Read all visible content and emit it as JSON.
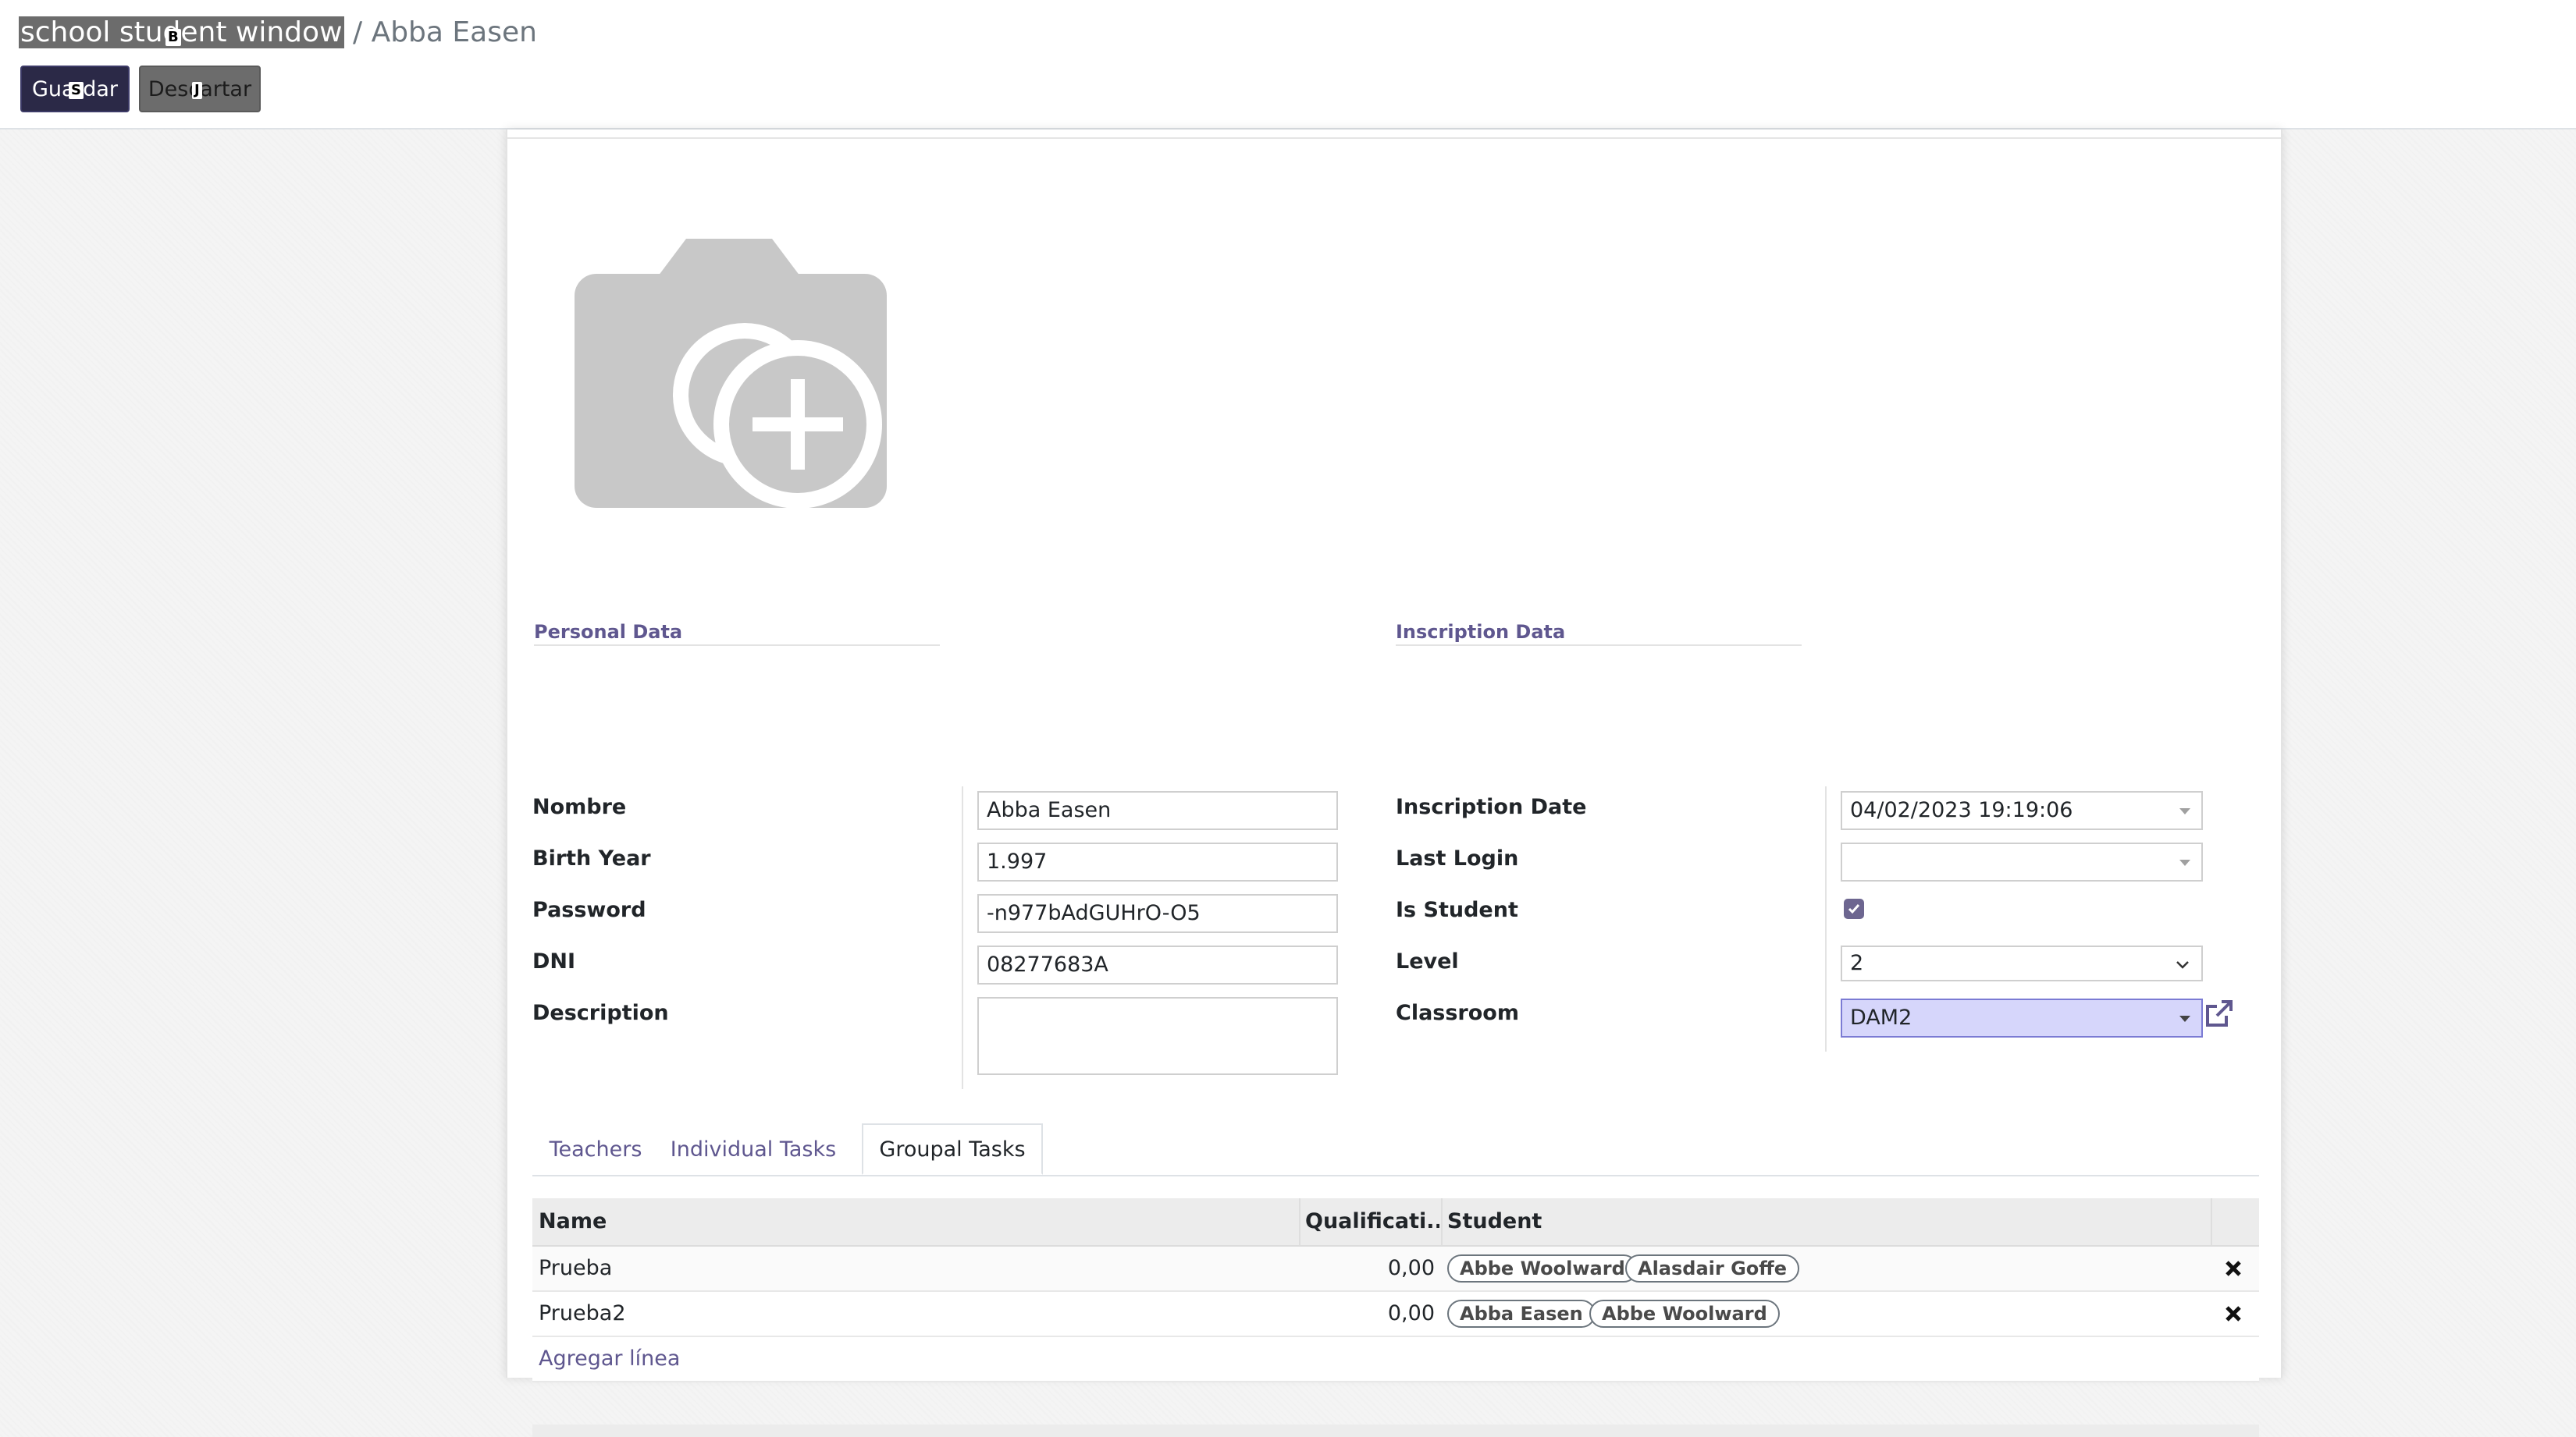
{
  "breadcrumb": {
    "parent": "school student window",
    "separator": "/",
    "current": "Abba Easen",
    "hotkey": "B"
  },
  "buttons": {
    "save_label": "Guardar",
    "save_hotkey": "S",
    "discard_label": "Descartar",
    "discard_hotkey": "J"
  },
  "personal_data": {
    "title": "Personal Data",
    "fields": {
      "nombre": {
        "label": "Nombre",
        "value": "Abba Easen"
      },
      "birth_year": {
        "label": "Birth Year",
        "value": "1.997"
      },
      "password": {
        "label": "Password",
        "value": "-n977bAdGUHrO-O5"
      },
      "dni": {
        "label": "DNI",
        "value": "08277683A"
      },
      "description": {
        "label": "Description",
        "value": ""
      }
    }
  },
  "inscription_data": {
    "title": "Inscription Data",
    "fields": {
      "inscription_date": {
        "label": "Inscription Date",
        "value": "04/02/2023 19:19:06"
      },
      "last_login": {
        "label": "Last Login",
        "value": ""
      },
      "is_student": {
        "label": "Is Student",
        "checked": true
      },
      "level": {
        "label": "Level",
        "value": "2"
      },
      "classroom": {
        "label": "Classroom",
        "value": "DAM2"
      }
    }
  },
  "tabs": [
    {
      "label": "Teachers",
      "active": false
    },
    {
      "label": "Individual Tasks",
      "active": false
    },
    {
      "label": "Groupal Tasks",
      "active": true
    }
  ],
  "table": {
    "columns": [
      "Name",
      "Qualificati...",
      "Student"
    ],
    "rows": [
      {
        "name": "Prueba",
        "qualification": "0,00",
        "students": [
          "Abbe Woolward",
          "Alasdair Goffe"
        ]
      },
      {
        "name": "Prueba2",
        "qualification": "0,00",
        "students": [
          "Abba Easen",
          "Abbe Woolward"
        ]
      }
    ],
    "add_line_label": "Agregar línea"
  },
  "icons": {
    "avatar": "camera-plus-icon",
    "external_link": "external-link-icon",
    "delete": "delete-x-icon",
    "checkbox": "check-icon"
  },
  "colors": {
    "accent": "#5f578f",
    "save_button": "#2b2947",
    "discard_button": "#6c6c6c",
    "checkbox": "#6d6690",
    "classroom_highlight": "#d6d6fb"
  }
}
